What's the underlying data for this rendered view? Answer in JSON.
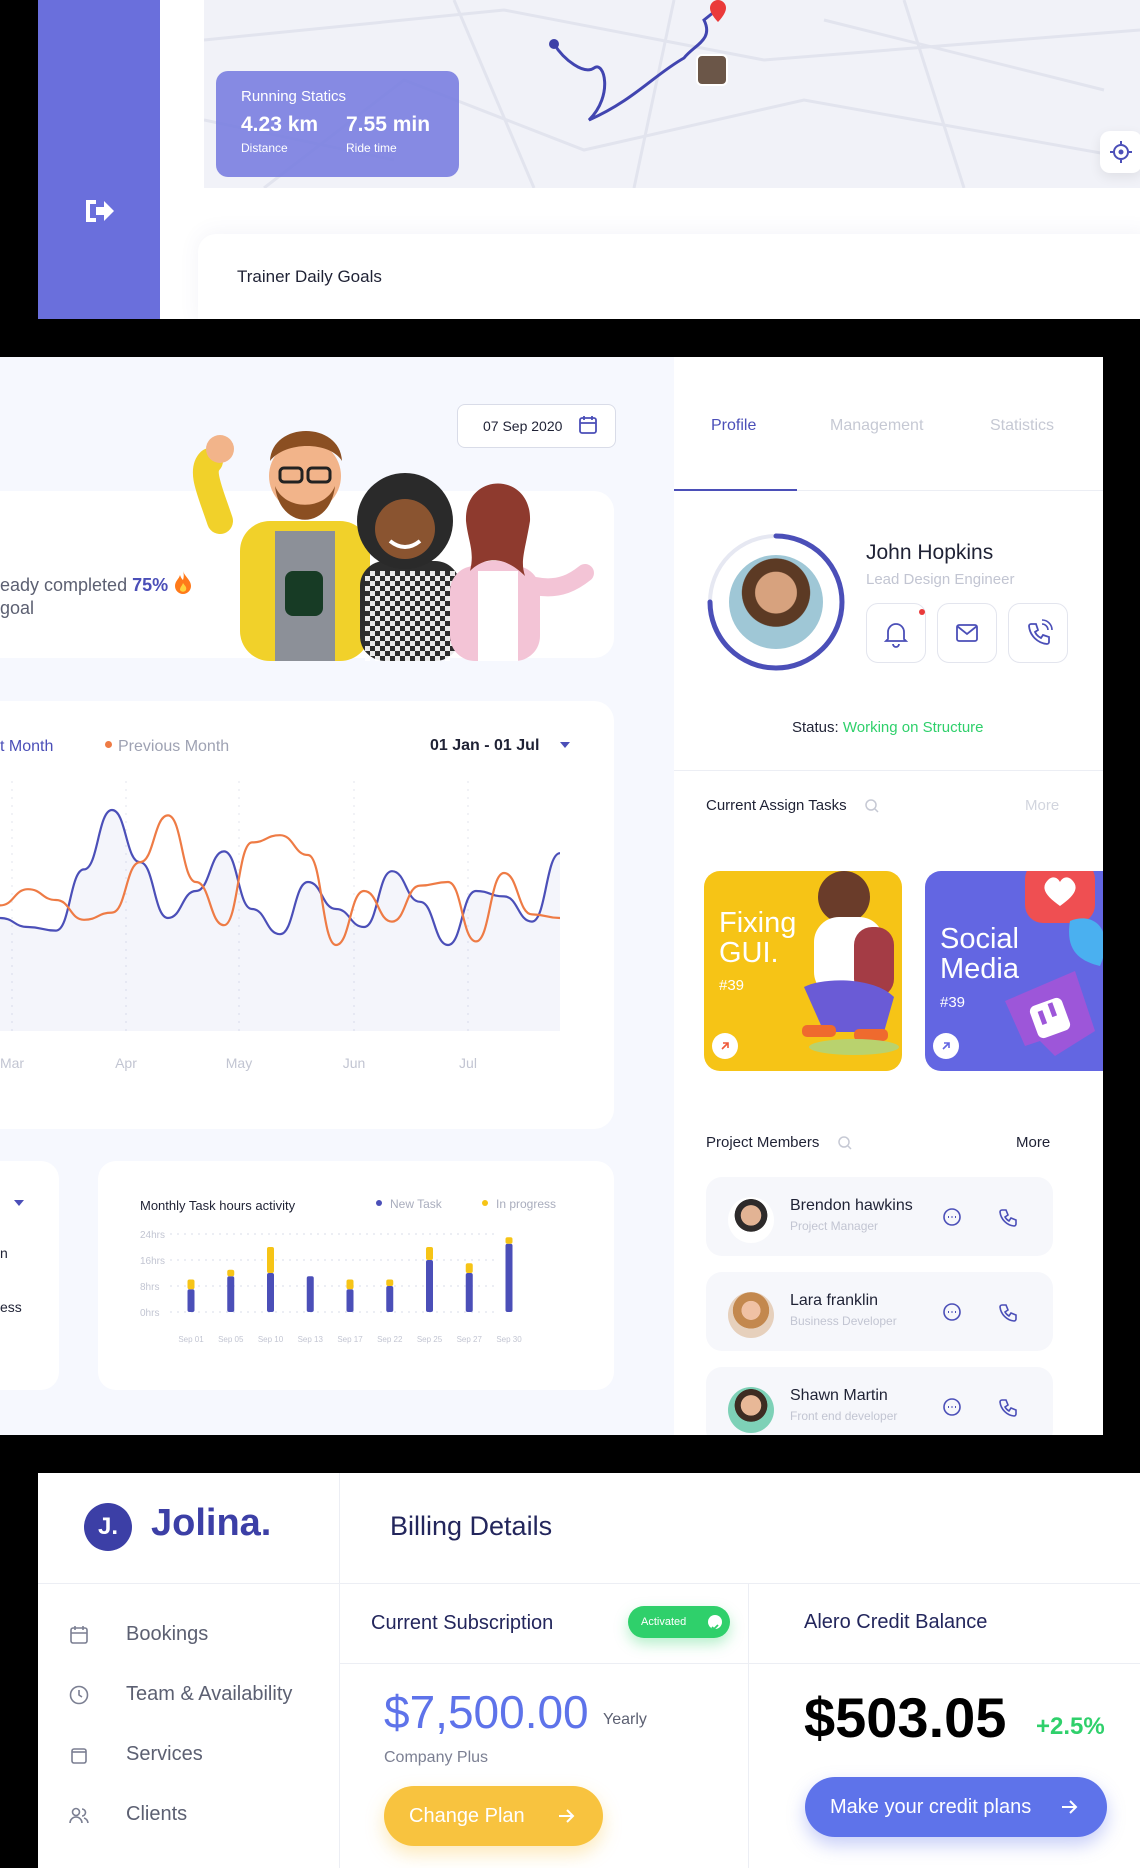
{
  "running": {
    "title": "Running Statics",
    "distance_value": "4.23 km",
    "distance_label": "Distance",
    "ride_value": "7.55 min",
    "ride_label": "Ride time"
  },
  "trainer": {
    "title": "Trainer Daily Goals"
  },
  "date_picker": {
    "value": "07 Sep 2020"
  },
  "goal": {
    "line1_prefix": "eady completed ",
    "percent": "75%",
    "line2": "goal"
  },
  "line_chart": {
    "legend_current": "t Month",
    "legend_previous": "Previous Month",
    "range": "01 Jan - 01 Jul",
    "months": [
      "Mar",
      "Apr",
      "May",
      "Jun",
      "Jul"
    ]
  },
  "chart_data": {
    "type": "line",
    "x": [
      "Mar",
      "Apr",
      "May",
      "Jun",
      "Jul"
    ],
    "series": [
      {
        "name": "Current Month",
        "color": "#4b4fb8",
        "values": [
          35,
          30,
          28,
          62,
          95,
          66,
          35,
          50,
          72,
          40,
          26,
          55,
          40,
          30,
          61,
          44,
          20,
          50,
          47,
          33,
          71
        ]
      },
      {
        "name": "Previous Month",
        "color": "#ee7b45",
        "values": [
          42,
          51,
          45,
          34,
          38,
          66,
          92,
          55,
          31,
          77,
          81,
          70,
          20,
          50,
          33,
          53,
          55,
          22,
          60,
          37,
          35
        ]
      }
    ],
    "ylim": [
      0,
      100
    ]
  },
  "bar_chart": {
    "title": "Monthly Task hours activity",
    "legend_new": "New Task",
    "legend_progress": "In progress",
    "y_ticks": [
      "24hrs",
      "16hrs",
      "8hrs",
      "0hrs"
    ],
    "x_ticks": [
      "Sep 01",
      "Sep 05",
      "Sep 10",
      "Sep 13",
      "Sep 17",
      "Sep 22",
      "Sep 25",
      "Sep 27",
      "Sep 30"
    ],
    "new_task": [
      7,
      11,
      12,
      11,
      7,
      8,
      16,
      12,
      21
    ],
    "in_progress": [
      3,
      2,
      8,
      0,
      3,
      2,
      4,
      3,
      2
    ],
    "ylim": [
      0,
      24
    ]
  },
  "left_cut": {
    "a": "n",
    "b": "ess"
  },
  "tabs": [
    "Profile",
    "Management",
    "Statistics"
  ],
  "profile": {
    "name": "John Hopkins",
    "role": "Lead Design Engineer",
    "status_label": "Status:",
    "status_value": "Working on Structure"
  },
  "tasks": {
    "title": "Current Assign Tasks",
    "more": "More",
    "cards": [
      {
        "title1": "Fixing",
        "title2": "GUI.",
        "num": "#39",
        "color": "#f6c416"
      },
      {
        "title1": "Social",
        "title2": "Media",
        "num": "#39",
        "color": "#6366e2"
      }
    ]
  },
  "members": {
    "title": "Project Members",
    "more": "More",
    "list": [
      {
        "name": "Brendon hawkins",
        "role": "Project Manager"
      },
      {
        "name": "Lara franklin",
        "role": "Business Developer"
      },
      {
        "name": "Shawn Martin",
        "role": "Front end developer"
      }
    ]
  },
  "brand": {
    "logo_letter": "J.",
    "name": "Jolina."
  },
  "nav": [
    "Bookings",
    "Team & Availability",
    "Services",
    "Clients"
  ],
  "billing": {
    "title": "Billing Details",
    "sub_title": "Current Subscription",
    "badge": "Activated",
    "price": "$7,500.00",
    "period": "Yearly",
    "plan": "Company Plus",
    "change_btn": "Change Plan",
    "credit_title": "Alero Credit Balance",
    "credit_value": "$503.05",
    "credit_change": "+2.5%",
    "credit_btn": "Make your credit plans"
  },
  "colors": {
    "accent": "#4b4fb8",
    "sidebar": "#6a6fdc",
    "yellow": "#f8c33f",
    "green": "#2fd06b",
    "orange": "#ee7b45"
  }
}
